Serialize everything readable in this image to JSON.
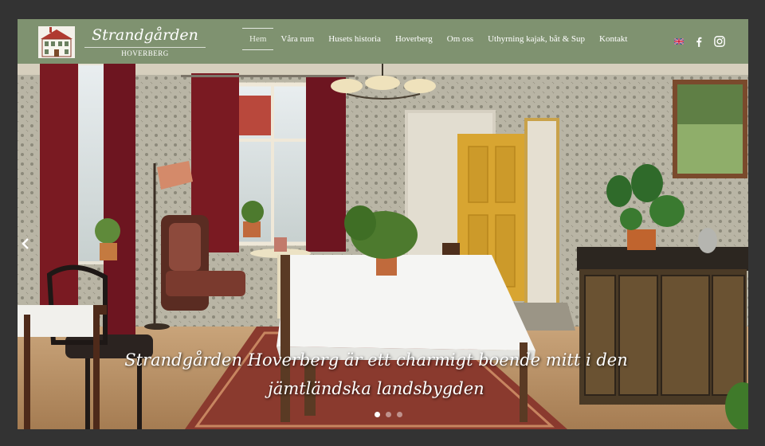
{
  "brand": {
    "name": "Strandgården",
    "subtitle": "HOVERBERG",
    "logo_icon": "house-icon"
  },
  "nav": {
    "items": [
      {
        "label": "Hem",
        "active": true
      },
      {
        "label": "Våra rum",
        "active": false
      },
      {
        "label": "Husets historia",
        "active": false
      },
      {
        "label": "Hoverberg",
        "active": false
      },
      {
        "label": "Om oss",
        "active": false
      },
      {
        "label": "Uthyrning kajak, båt & Sup",
        "active": false
      },
      {
        "label": "Kontakt",
        "active": false
      }
    ],
    "icons": [
      "uk-flag-icon",
      "facebook-icon",
      "instagram-icon"
    ]
  },
  "hero": {
    "caption_line1": "Strandgården Hoverberg är ett charmigt boende mitt i den",
    "caption_line2": "jämtländska landsbygden",
    "slides_total": 3,
    "active_slide": 1,
    "prev_icon": "chevron-left-icon"
  },
  "colors": {
    "navbar": "#7f9270",
    "outer_background": "#333333",
    "door": "#d8a531",
    "curtain": "#7a1a22"
  }
}
